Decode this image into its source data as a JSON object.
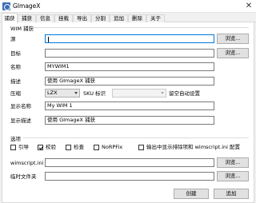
{
  "window": {
    "title": "GImageX"
  },
  "tabs": [
    "捕获",
    "捕获",
    "信息",
    "挂载",
    "导出",
    "分割",
    "追加",
    "删除",
    "关于"
  ],
  "wim_info": {
    "group_title": "WIM 捕获",
    "source_label": "源",
    "source_value": "",
    "target_label": "目标",
    "target_value": "",
    "name_label": "名称",
    "name_value": "MYWIM1",
    "desc_label": "描述",
    "desc_value": "使用 GImageX 捕获",
    "compress_label": "压缩",
    "compress_value": "LZX",
    "sku_label": "SKU 标识",
    "sku_value": "",
    "autoset_label": "留空自动设置",
    "display_name_label": "显示名称",
    "display_name_value": "My WIM 1",
    "display_desc_label": "显示描述",
    "display_desc_value": "使用 GImageX 捕获",
    "browse_label": "浏览..."
  },
  "options": {
    "group_title": "选项",
    "checkboxes": [
      {
        "label": "引导",
        "checked": false
      },
      {
        "label": "校验",
        "checked": true
      },
      {
        "label": "检查",
        "checked": false
      },
      {
        "label": "NoRPFix",
        "checked": false
      },
      {
        "label": "输出中显示排除项和 wimscript.ini 配置",
        "checked": false
      }
    ],
    "wimscript_label": "wimscript.ini",
    "wimscript_value": "",
    "temp_label": "临时文件夹",
    "temp_value": ""
  },
  "footer": {
    "create_label": "创建",
    "append_label": "追加"
  }
}
